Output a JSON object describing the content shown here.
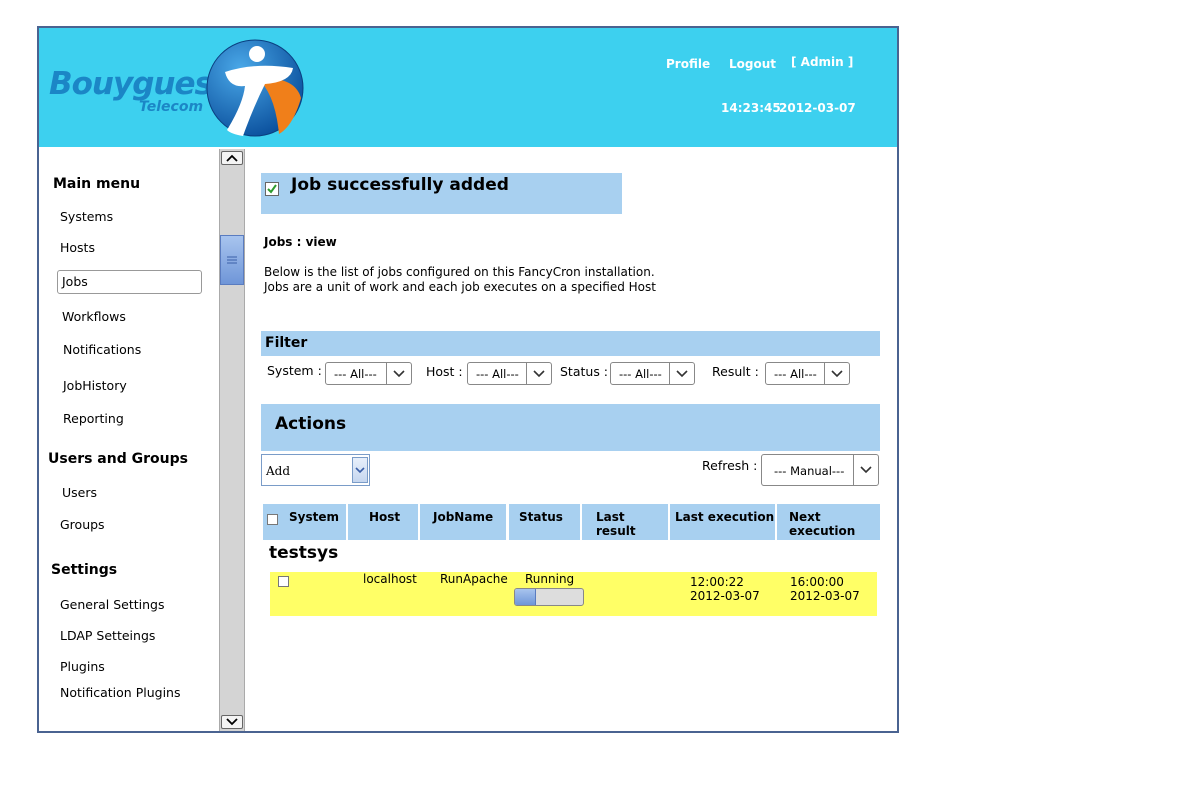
{
  "header": {
    "brand": "Bouygues",
    "brand_sub": "Telecom",
    "profile": "Profile",
    "logout": "Logout",
    "admin": "[ Admin ]",
    "time": "14:23:45",
    "date": "2012-03-07",
    "bg_color": "#3dd0ef"
  },
  "sidebar": {
    "main_menu": "Main menu",
    "main_items": [
      "Systems",
      "Hosts",
      "Jobs",
      "Workflows",
      "Notifications",
      "JobHistory",
      "Reporting"
    ],
    "active_item": "Jobs",
    "users_groups": "Users and Groups",
    "users_items": [
      "Users",
      "Groups"
    ],
    "settings": "Settings",
    "settings_items": [
      "General Settings",
      "LDAP Setteings",
      "Plugins",
      "Notification Plugins"
    ]
  },
  "main": {
    "success": "Job successfully added",
    "section_title": "Jobs : view",
    "desc_line1": "Below is the list of jobs configured on this FancyCron installation.",
    "desc_line2": "Jobs are a unit of work and each job executes on a specified Host",
    "filter": {
      "title": "Filter",
      "system_label": "System :",
      "system_value": "--- All---",
      "host_label": "Host :",
      "host_value": "--- All---",
      "status_label": "Status :",
      "status_value": "--- All---",
      "result_label": "Result :",
      "result_value": "--- All---"
    },
    "actions": {
      "title": "Actions",
      "add_value": "Add",
      "refresh_label": "Refresh :",
      "refresh_value": "--- Manual---"
    },
    "table": {
      "headers": [
        "System",
        "Host",
        "JobName",
        "Status",
        "Last result",
        "Last execution",
        "Next execution"
      ],
      "group": "testsys",
      "rows": [
        {
          "host": "localhost",
          "jobname": "RunApache",
          "status": "Running",
          "progress_pct": 30,
          "last_exec_time": "12:00:22",
          "last_exec_date": "2012-03-07",
          "next_exec_time": "16:00:00",
          "next_exec_date": "2012-03-07"
        }
      ]
    }
  }
}
